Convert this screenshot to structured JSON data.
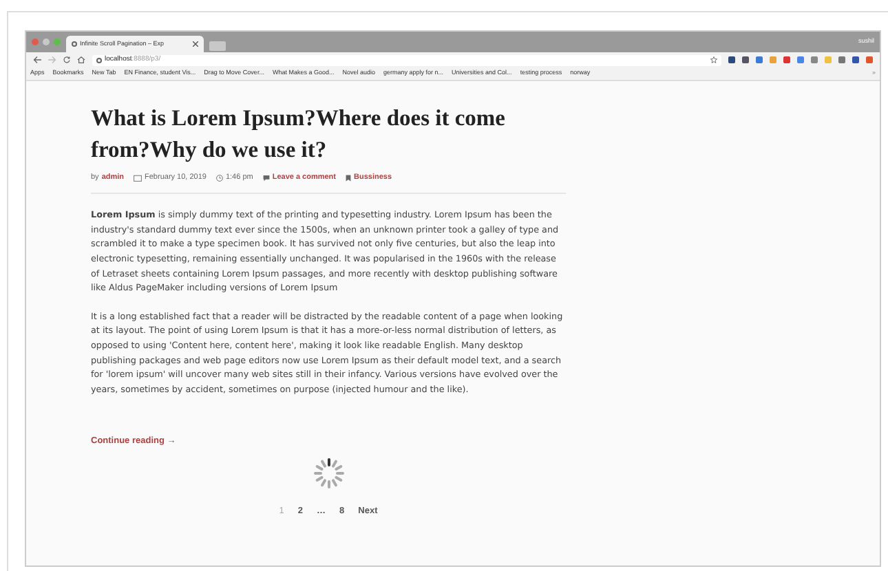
{
  "browser": {
    "tab_title": "Infinite Scroll Pagination – Exp",
    "profile": "sushil",
    "url_host": "localhost",
    "url_path": ":8888/p3/",
    "bookmarks": [
      {
        "label": "Apps"
      },
      {
        "label": "Bookmarks"
      },
      {
        "label": "New Tab"
      },
      {
        "label": "EN Finance, student Vis..."
      },
      {
        "label": "Drag to Move Cover..."
      },
      {
        "label": "What Makes a Good..."
      },
      {
        "label": "Novel audio"
      },
      {
        "label": "germany apply for n..."
      },
      {
        "label": "Universities and Col..."
      },
      {
        "label": "testing process"
      },
      {
        "label": "norway"
      }
    ],
    "overflow": "»"
  },
  "post": {
    "title": "What is Lorem Ipsum?Where does it come from?Why do we use it?",
    "meta": {
      "by": "by",
      "author": "admin",
      "date": "February 10, 2019",
      "time": "1:46 pm",
      "comments": "Leave a comment",
      "category": "Bussiness"
    },
    "paragraphs": [
      "**Lorem Ipsum** is simply dummy text of the printing and typesetting industry. Lorem Ipsum has been the industry's standard dummy text ever since the 1500s, when an unknown printer took a galley of type and scrambled it to make a type specimen book. It has survived not only five centuries, but also the leap into electronic typesetting, remaining essentially unchanged. It was popularised in the 1960s with the release of Letraset sheets containing Lorem Ipsum passages, and more recently with desktop publishing software like Aldus PageMaker including versions of Lorem Ipsum",
      "It is a long established fact that a reader will be distracted by the readable content of a page when looking at its layout. The point of using Lorem Ipsum is that it has a more-or-less normal distribution of letters, as opposed to using 'Content here, content here', making it look like readable English. Many desktop publishing packages and web page editors now use Lorem Ipsum as their default model text, and a search for 'lorem ipsum' will uncover many web sites still in their infancy. Various versions have evolved over the years, sometimes by accident, sometimes on purpose (injected humour and the like)."
    ],
    "continue": "Continue reading →"
  },
  "pagination": [
    {
      "label": "1",
      "selected": true
    },
    {
      "label": "2",
      "selected": false
    },
    {
      "label": "…",
      "selected": false
    },
    {
      "label": "8",
      "selected": false
    },
    {
      "label": "Next",
      "selected": false
    }
  ]
}
